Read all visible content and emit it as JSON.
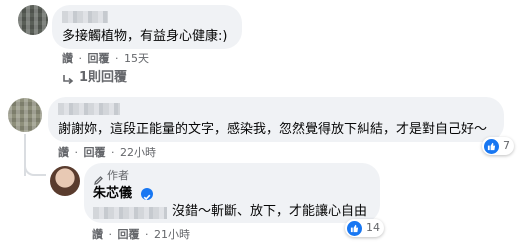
{
  "comments": [
    {
      "text": "多接觸植物，有益身心健康:)",
      "actions": {
        "like": "讚",
        "reply": "回覆",
        "time": "15天"
      },
      "replies_link": "1則回覆"
    },
    {
      "text": "謝謝妳，這段正能量的文字，感染我，忽然覺得放下糾結，才是對自己好～",
      "actions": {
        "like": "讚",
        "reply": "回覆",
        "time": "22小時"
      },
      "reaction_count": "7",
      "reply": {
        "badge": "作者",
        "author": "朱芯儀",
        "text": "沒錯～斬斷、放下，才能讓心自由",
        "actions": {
          "like": "讚",
          "reply": "回覆",
          "time": "21小時"
        },
        "reaction_count": "14"
      }
    }
  ],
  "separator": "·",
  "colors": {
    "accent": "#1877f2",
    "bubble": "#f0f2f5",
    "meta": "#65676b"
  }
}
